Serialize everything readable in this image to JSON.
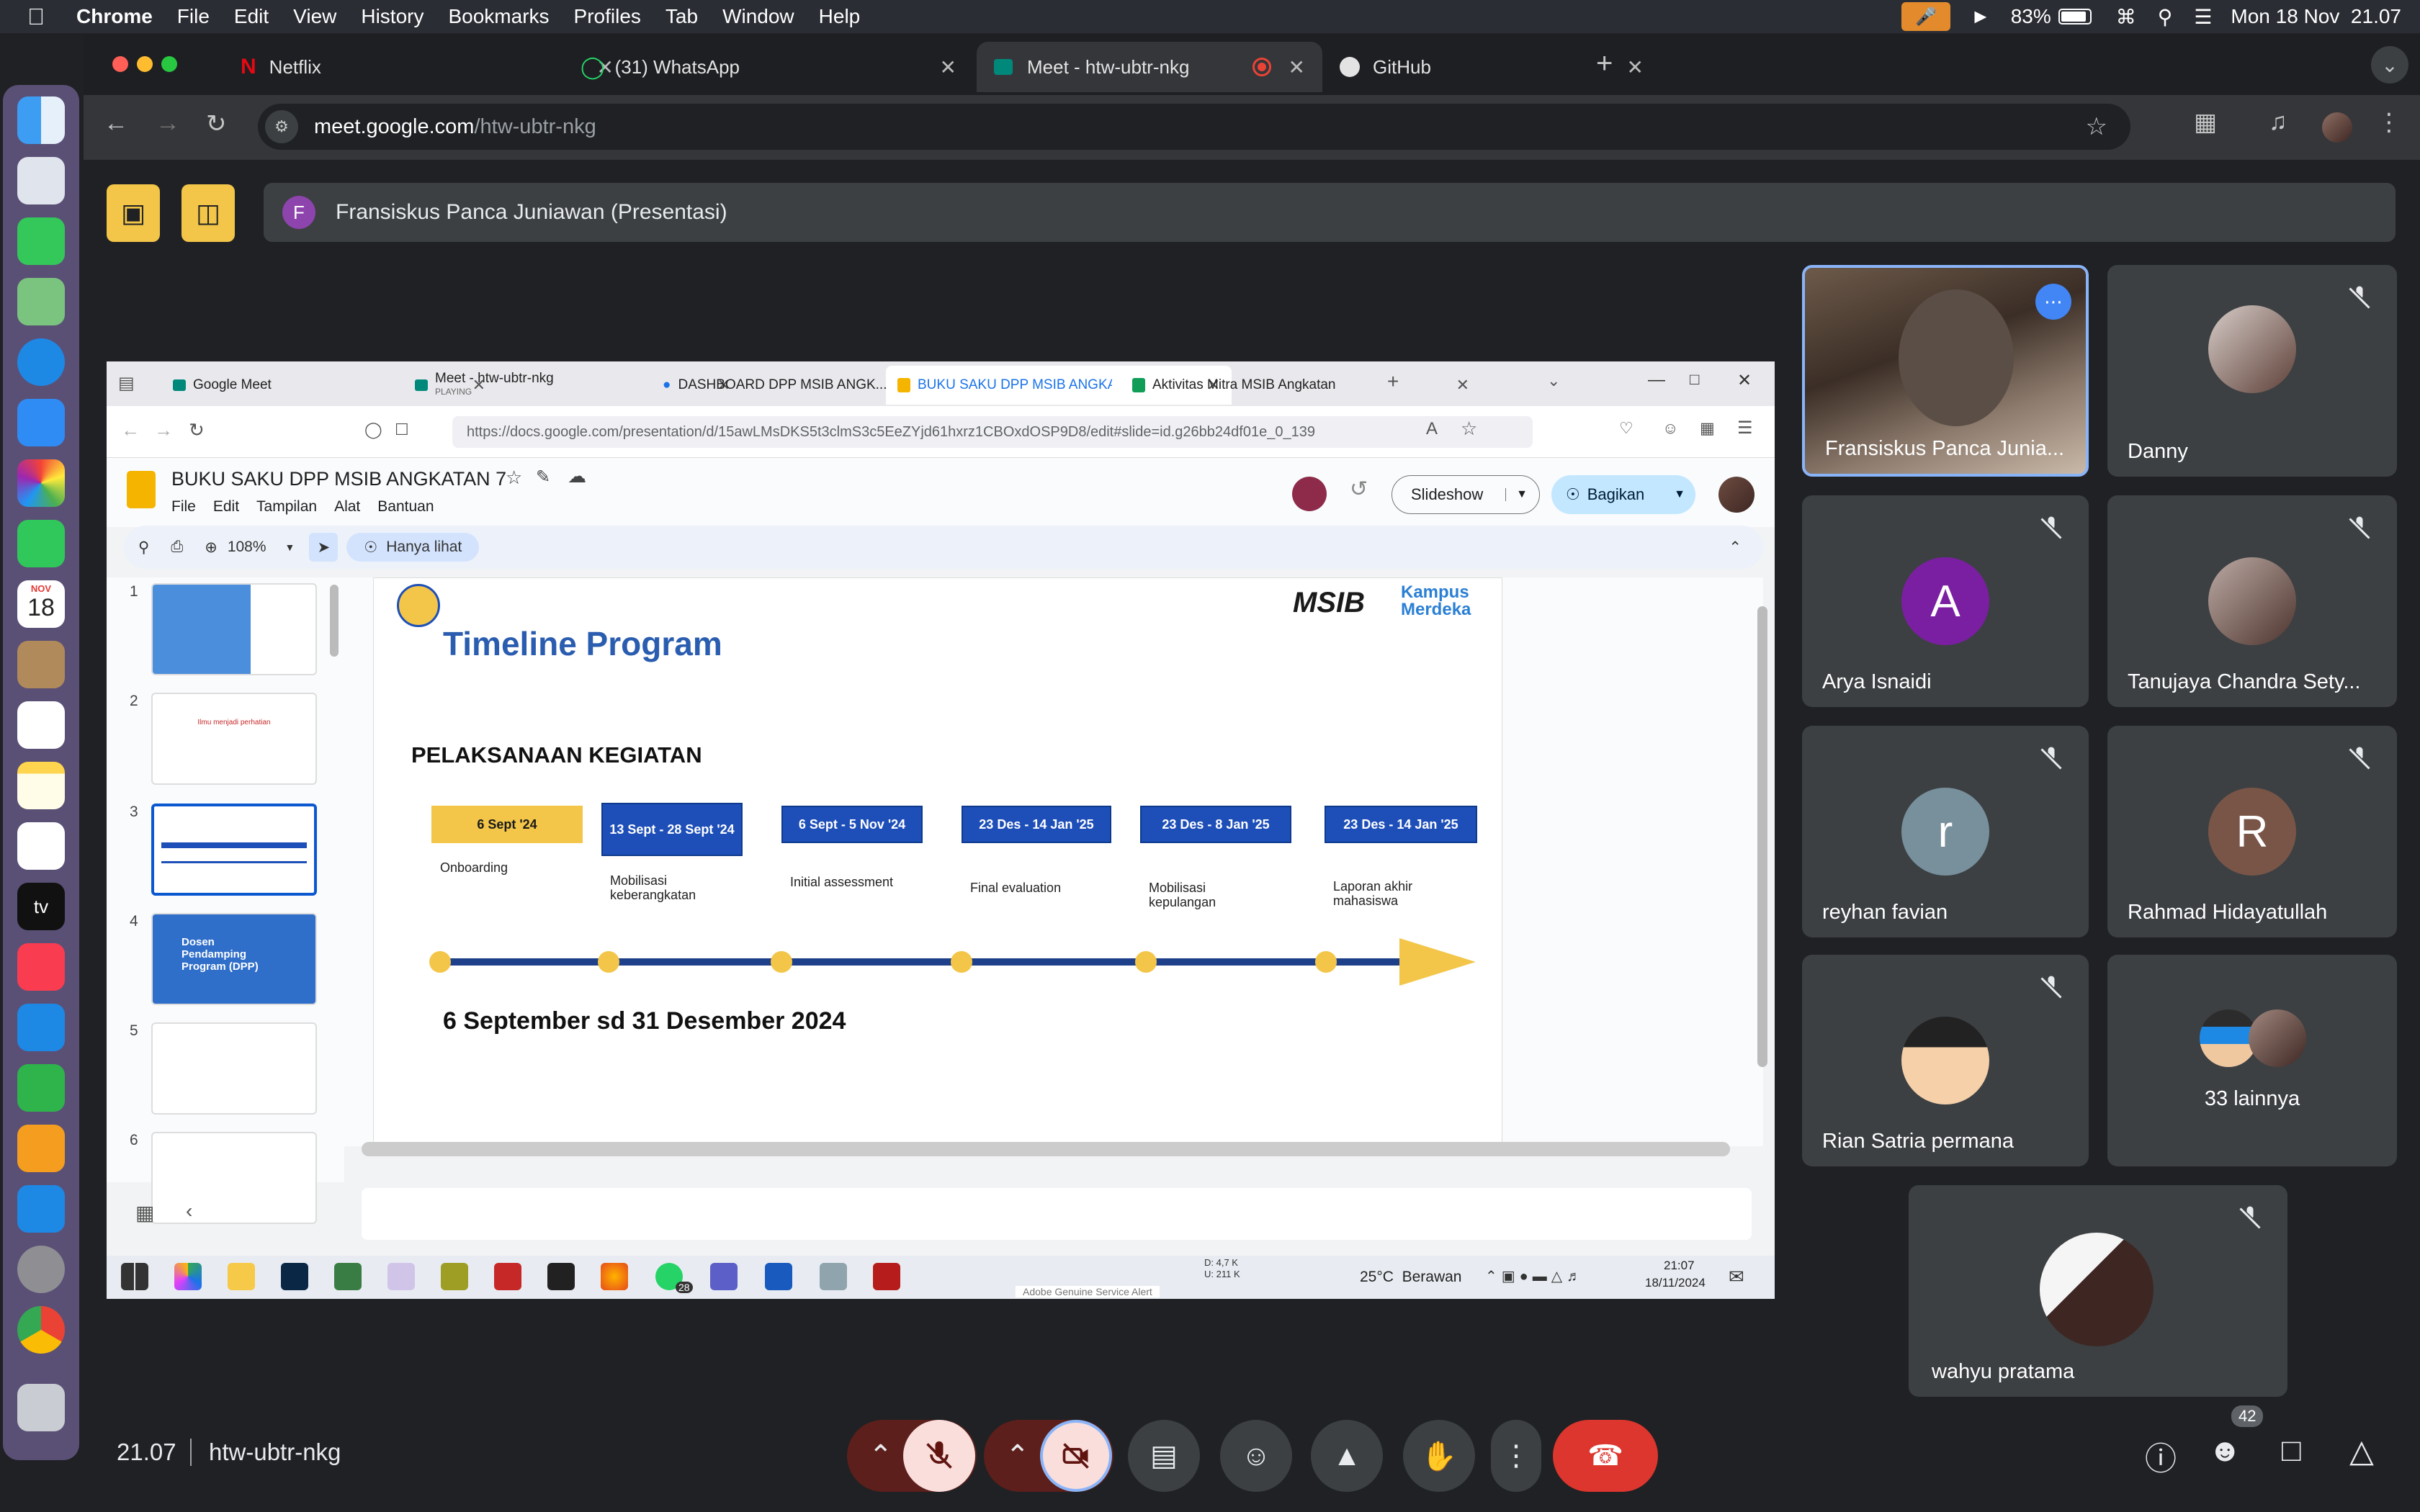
{
  "mac_menubar": {
    "app": "Chrome",
    "menus": [
      "File",
      "Edit",
      "View",
      "History",
      "Bookmarks",
      "Profiles",
      "Tab",
      "Window",
      "Help"
    ],
    "battery": "83%",
    "datetime": "Mon 18 Nov  21.07"
  },
  "dock": {
    "calendar_month": "NOV",
    "calendar_day": "18",
    "tv_label": "tv"
  },
  "chrome": {
    "tabs": [
      {
        "label": "Netflix"
      },
      {
        "label": "(31) WhatsApp"
      },
      {
        "label": "Meet - htw-ubtr-nkg",
        "active": true
      },
      {
        "label": "GitHub"
      }
    ],
    "url_host": "meet.google.com",
    "url_path": "/htw-ubtr-nkg"
  },
  "meet": {
    "presenter_initial": "F",
    "presenter_banner": "Fransiskus Panca Juniawan (Presentasi)",
    "meeting_time": "21.07",
    "meeting_code": "htw-ubtr-nkg",
    "participant_count": "42",
    "participants": [
      {
        "name": "Fransiskus Panca Junia...",
        "speaking": true
      },
      {
        "name": "Danny",
        "muted": true
      },
      {
        "name": "Arya Isnaidi",
        "initial": "A",
        "color": "#7b1fa2",
        "muted": true
      },
      {
        "name": "Tanujaya Chandra Sety...",
        "muted": true
      },
      {
        "name": "reyhan favian",
        "initial": "r",
        "color": "#78909c",
        "muted": true
      },
      {
        "name": "Rahmad Hidayatullah",
        "initial": "R",
        "color": "#795548",
        "muted": true
      },
      {
        "name": "Rian Satria permana",
        "muted": true
      },
      {
        "name": "33 lainnya"
      },
      {
        "name": "wahyu pratama",
        "muted": true
      }
    ]
  },
  "shared_screen": {
    "ff_tabs": [
      {
        "label": "Google Meet"
      },
      {
        "label": "Meet - htw-ubtr-nkg",
        "sub": "PLAYING"
      },
      {
        "label": "DASHBOARD DPP MSIB ANGK..."
      },
      {
        "label": "BUKU SAKU DPP MSIB ANGKAT",
        "active": true
      },
      {
        "label": "Aktivitas Mitra MSIB Angkatan"
      }
    ],
    "url": "https://docs.google.com/presentation/d/15awLMsDKS5t3clmS3c5EeZYjd61hxrz1CBOxdOSP9D8/edit#slide=id.g26bb24df01e_0_139",
    "doc_title": "BUKU SAKU DPP MSIB ANGKATAN 7",
    "menus": [
      "File",
      "Edit",
      "Tampilan",
      "Alat",
      "Bantuan"
    ],
    "slideshow": "Slideshow",
    "share": "Bagikan",
    "zoom": "108%",
    "view_mode": "Hanya lihat",
    "thumb_numbers": [
      "1",
      "2",
      "3",
      "4",
      "5",
      "6"
    ],
    "thumb2_text": "Ilmu menjadi perhatian",
    "thumb4_text": "Dosen Pendamping Program (DPP)",
    "slide": {
      "title": "Timeline Program",
      "logo_msib": "MSIB",
      "logo_kampus": "Kampus Merdeka",
      "section": "PELAKSANAAN KEGIATAN",
      "items": [
        {
          "date": "6 Sept '24",
          "label": "Onboarding",
          "color": "#f3c649",
          "text_color": "#1a1a1a"
        },
        {
          "date": "13 Sept - 28 Sept '24",
          "label": "Mobilisasi keberangkatan",
          "color": "#1e4fb8",
          "text_color": "#ffffff"
        },
        {
          "date": "6 Sept - 5 Nov '24",
          "label": "Initial assessment",
          "color": "#1e4fb8",
          "text_color": "#ffffff"
        },
        {
          "date": "23 Des - 14 Jan '25",
          "label": "Final evaluation",
          "color": "#1e4fb8",
          "text_color": "#ffffff"
        },
        {
          "date": "23 Des - 8 Jan '25",
          "label": "Mobilisasi kepulangan",
          "color": "#1e4fb8",
          "text_color": "#ffffff"
        },
        {
          "date": "23 Des - 14 Jan '25",
          "label": "Laporan akhir mahasiswa",
          "color": "#1e4fb8",
          "text_color": "#ffffff"
        }
      ],
      "footer": "6 September sd 31 Desember 2024"
    },
    "win_taskbar": {
      "weather": "25°C  Berawan",
      "time": "21:07",
      "date": "18/11/2024",
      "net_d": "D: 4,7 K",
      "net_u": "U: 211 K",
      "alert": "Adobe Genuine Service Alert",
      "badge": "28"
    }
  },
  "colors": {
    "accent_blue": "#8ab4f8",
    "hangup": "#dc362e",
    "yellow": "#f3c649"
  }
}
